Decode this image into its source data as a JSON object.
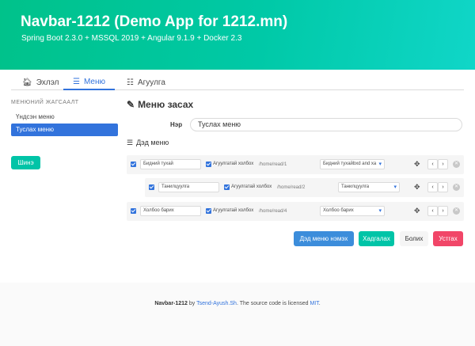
{
  "hero": {
    "title": "Navbar-1212 (Demo App for 1212.mn)",
    "subtitle": "Spring Boot 2.3.0 + MSSQL 2019 + Angular 9.1.9 + Docker 2.3"
  },
  "tabs": [
    {
      "label": "Эхлэл",
      "icon": "home-icon",
      "active": false
    },
    {
      "label": "Меню",
      "icon": "menu-icon",
      "active": true
    },
    {
      "label": "Агуулга",
      "icon": "list-icon",
      "active": false
    }
  ],
  "sidebar": {
    "label": "МЕНЮНИЙ ЖАГСААЛТ",
    "items": [
      {
        "label": "Үндсэн меню",
        "active": false
      },
      {
        "label": "Туслах меню",
        "active": true
      }
    ],
    "new_label": "Шинэ"
  },
  "form": {
    "title": "Меню засах",
    "name_label": "Нэр",
    "name_value": "Туслах меню",
    "submenu_title": "Дэд меню"
  },
  "rows": [
    {
      "name": "Бидний тухай",
      "checked": true,
      "custom_label": "Агуулгатай холбох",
      "custom_checked": true,
      "path": "/home/read/1",
      "select": "Бидний тухайbxd and xa"
    },
    {
      "name": "Танилцуулга",
      "checked": true,
      "custom_label": "Агуулгатай холбох",
      "custom_checked": true,
      "path": "/home/read/2",
      "select": "Танилцуулга"
    },
    {
      "name": "Холбоо барих",
      "checked": true,
      "custom_label": "Агуулгатай холбох",
      "custom_checked": true,
      "path": "/home/read/4",
      "select": "Холбоо барих"
    }
  ],
  "actions": {
    "add_sub": "Дэд меню нэмэх",
    "save": "Хадгалах",
    "cancel": "Болих",
    "delete": "Устгах"
  },
  "footer": {
    "brand": "Navbar-1212",
    "by": " by ",
    "author": "Tsend-Ayush.Sh",
    "mid": ". The source code is licensed ",
    "license": "MIT",
    "end": "."
  },
  "colors": {
    "primary": "#3273dc",
    "accent": "#00c4a7",
    "danger": "#f14668"
  }
}
